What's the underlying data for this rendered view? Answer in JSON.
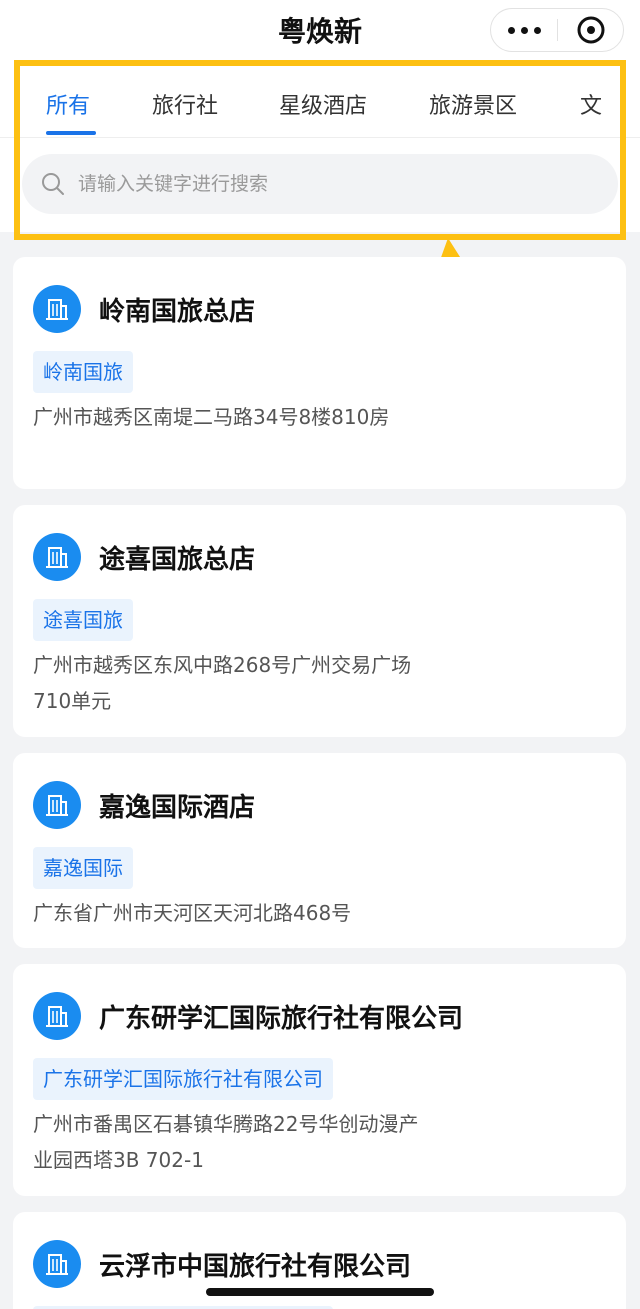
{
  "navbar": {
    "title": "粤焕新"
  },
  "tabs": [
    {
      "label": "所有",
      "active": true
    },
    {
      "label": "旅行社",
      "active": false
    },
    {
      "label": "星级酒店",
      "active": false
    },
    {
      "label": "旅游景区",
      "active": false
    },
    {
      "label": "文",
      "active": false
    }
  ],
  "search": {
    "placeholder": "请输入关键字进行搜索"
  },
  "colors": {
    "accent": "#1a73e8",
    "highlight": "#fdc012",
    "icon_bg": "#1a8cf0"
  },
  "icons": {
    "more": "more-dots-icon",
    "close": "close-circle-icon",
    "search": "search-icon",
    "building": "building-icon"
  },
  "cards": [
    {
      "title": "岭南国旅总店",
      "tag": "岭南国旅",
      "address": "广州市越秀区南堤二马路34号8楼810房"
    },
    {
      "title": "途喜国旅总店",
      "tag": "途喜国旅",
      "address": "广州市越秀区东风中路268号广州交易广场710单元"
    },
    {
      "title": "嘉逸国际酒店",
      "tag": "嘉逸国际",
      "address": "广东省广州市天河区天河北路468号"
    },
    {
      "title": "广东研学汇国际旅行社有限公司",
      "tag": "广东研学汇国际旅行社有限公司",
      "address": "广州市番禺区石碁镇华腾路22号华创动漫产业园西塔3B 702-1"
    },
    {
      "title": "云浮市中国旅行社有限公司",
      "tag": "",
      "address": ""
    }
  ]
}
